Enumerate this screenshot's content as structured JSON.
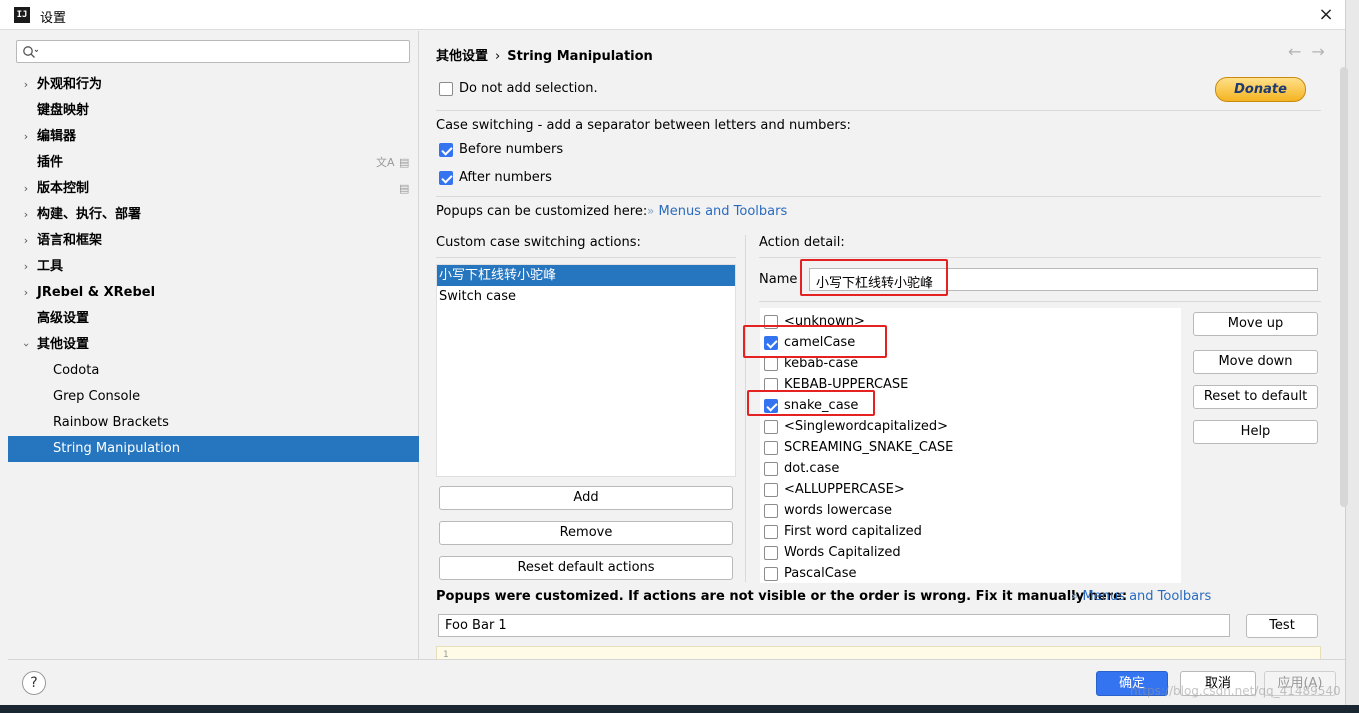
{
  "window": {
    "title": "设置",
    "app_icon": "IJ",
    "close_icon": "×"
  },
  "sidebar": {
    "search_placeholder": "",
    "items": [
      {
        "label": "外观和行为",
        "expandable": true
      },
      {
        "label": "键盘映射",
        "expandable": false
      },
      {
        "label": "编辑器",
        "expandable": true
      },
      {
        "label": "插件",
        "expandable": false
      },
      {
        "label": "版本控制",
        "expandable": true
      },
      {
        "label": "构建、执行、部署",
        "expandable": true
      },
      {
        "label": "语言和框架",
        "expandable": true
      },
      {
        "label": "工具",
        "expandable": true
      },
      {
        "label": "JRebel & XRebel",
        "expandable": true
      },
      {
        "label": "高级设置",
        "expandable": false
      },
      {
        "label": "其他设置",
        "expandable": true,
        "expanded": true
      },
      {
        "label": "Codota",
        "child": true
      },
      {
        "label": "Grep Console",
        "child": true
      },
      {
        "label": "Rainbow Brackets",
        "child": true
      },
      {
        "label": "String Manipulation",
        "child": true,
        "selected": true
      }
    ]
  },
  "header": {
    "parent": "其他设置",
    "separator": "›",
    "current": "String Manipulation",
    "back_arrow": "←",
    "forward_arrow": "→"
  },
  "options": {
    "no_selection": "Do not add selection.",
    "donate": "Donate",
    "case_switching_label": "Case switching - add a separator between letters and numbers:",
    "before_numbers": "Before numbers",
    "after_numbers": "After numbers",
    "popups_label": "Popups can be customized here:",
    "popups_link": "Menus and Toolbars",
    "link_chevron": "»"
  },
  "actions": {
    "header": "Custom case switching actions:",
    "items": [
      "小写下杠线转小驼峰",
      "Switch case"
    ],
    "add": "Add",
    "remove": "Remove",
    "reset": "Reset default actions"
  },
  "detail": {
    "header": "Action detail:",
    "name_label": "Name",
    "name_value": "小写下杠线转小驼峰",
    "styles": [
      {
        "label": "<unknown>",
        "checked": false
      },
      {
        "label": "camelCase",
        "checked": true
      },
      {
        "label": "kebab-case",
        "checked": false
      },
      {
        "label": "KEBAB-UPPERCASE",
        "checked": false
      },
      {
        "label": "snake_case",
        "checked": true
      },
      {
        "label": "<Singlewordcapitalized>",
        "checked": false
      },
      {
        "label": "SCREAMING_SNAKE_CASE",
        "checked": false
      },
      {
        "label": "dot.case",
        "checked": false
      },
      {
        "label": "<ALLUPPERCASE>",
        "checked": false
      },
      {
        "label": "words lowercase",
        "checked": false
      },
      {
        "label": "First word capitalized",
        "checked": false
      },
      {
        "label": "Words Capitalized",
        "checked": false
      },
      {
        "label": "PascalCase",
        "checked": false
      }
    ],
    "move_up": "Move up",
    "move_down": "Move down",
    "reset_default": "Reset to default",
    "help": "Help"
  },
  "footer_section": {
    "notice": "Popups were customized. If actions are not visible or the order is wrong. Fix it manually here:",
    "notice_link": "Menus and Toolbars",
    "test_input": "Foo Bar 1",
    "test_button": "Test",
    "result_line": "1"
  },
  "bottom": {
    "help": "?",
    "ok": "确定",
    "cancel": "取消",
    "apply": "应用(A)"
  },
  "watermark": "https://blog.csdn.net/qq_41489540",
  "colors": {
    "accent": "#2675bf",
    "checkbox": "#3574f0",
    "highlight": "#e52222",
    "link": "#2a6bbf"
  }
}
